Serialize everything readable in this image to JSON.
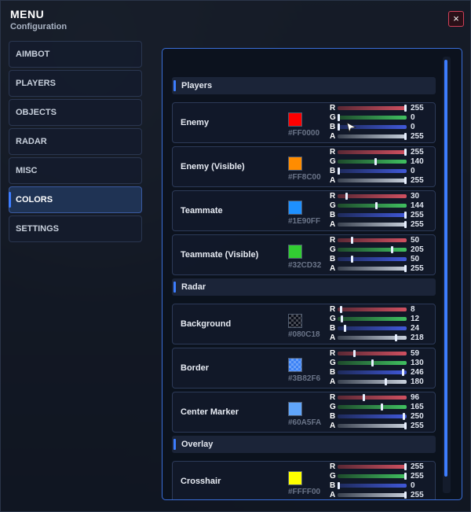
{
  "menu": {
    "title": "MENU",
    "subtitle": "Configuration",
    "close_icon": "×"
  },
  "sidebar": {
    "items": [
      {
        "label": "AIMBOT",
        "active": false
      },
      {
        "label": "PLAYERS",
        "active": false
      },
      {
        "label": "OBJECTS",
        "active": false
      },
      {
        "label": "RADAR",
        "active": false
      },
      {
        "label": "MISC",
        "active": false
      },
      {
        "label": "COLORS",
        "active": true
      },
      {
        "label": "SETTINGS",
        "active": false
      }
    ]
  },
  "sections": [
    {
      "title": "Players",
      "rows": [
        {
          "label": "Enemy",
          "color": "#FF0000",
          "hex": "#FF0000",
          "r": 255,
          "g": 0,
          "b": 0,
          "a": 255
        },
        {
          "label": "Enemy (Visible)",
          "color": "#FF8C00",
          "hex": "#FF8C00",
          "r": 255,
          "g": 140,
          "b": 0,
          "a": 255
        },
        {
          "label": "Teammate",
          "color": "#1E90FF",
          "hex": "#1E90FF",
          "r": 30,
          "g": 144,
          "b": 255,
          "a": 255
        },
        {
          "label": "Teammate (Visible)",
          "color": "#32CD32",
          "hex": "#32CD32",
          "r": 50,
          "g": 205,
          "b": 50,
          "a": 255
        }
      ]
    },
    {
      "title": "Radar",
      "rows": [
        {
          "label": "Background",
          "color": "#080C18",
          "hex": "#080C18",
          "r": 8,
          "g": 12,
          "b": 24,
          "a": 218
        },
        {
          "label": "Border",
          "color": "#3B82F6",
          "hex": "#3B82F6",
          "r": 59,
          "g": 130,
          "b": 246,
          "a": 180
        },
        {
          "label": "Center Marker",
          "color": "#60A5FA",
          "hex": "#60A5FA",
          "r": 96,
          "g": 165,
          "b": 250,
          "a": 255
        }
      ]
    },
    {
      "title": "Overlay",
      "rows": [
        {
          "label": "Crosshair",
          "color": "#FFFF00",
          "hex": "#FFFF00",
          "r": 255,
          "g": 255,
          "b": 0,
          "a": 255
        }
      ]
    }
  ],
  "channel_letters": [
    "R",
    "G",
    "B",
    "A"
  ],
  "accent_color": "#3D7DFF"
}
